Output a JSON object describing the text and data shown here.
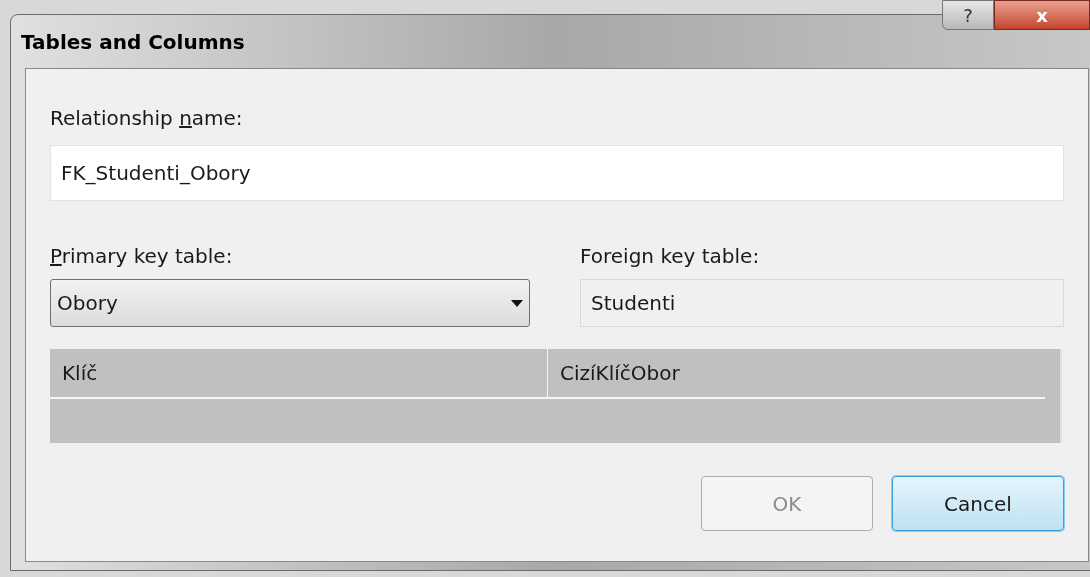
{
  "window": {
    "title": "Tables and Columns",
    "help_button": "?",
    "close_button": "x"
  },
  "relationship_name": {
    "label": {
      "text": "Relationship ",
      "key": "n",
      "rest": "ame:"
    },
    "value": "FK_Studenti_Obory"
  },
  "primary_key_table": {
    "label": {
      "key": "P",
      "rest": "rimary key table:"
    },
    "value": "Obory"
  },
  "foreign_key_table": {
    "label": {
      "text": "Foreign key table:"
    },
    "value": "Studenti",
    "disabled": true
  },
  "grid": {
    "columns": [
      "Klíč",
      "CizíKlíčObor"
    ]
  },
  "buttons": [
    {
      "label": "OK",
      "disabled": true,
      "default": false
    },
    {
      "label": "Cancel",
      "disabled": false,
      "default": true
    }
  ]
}
